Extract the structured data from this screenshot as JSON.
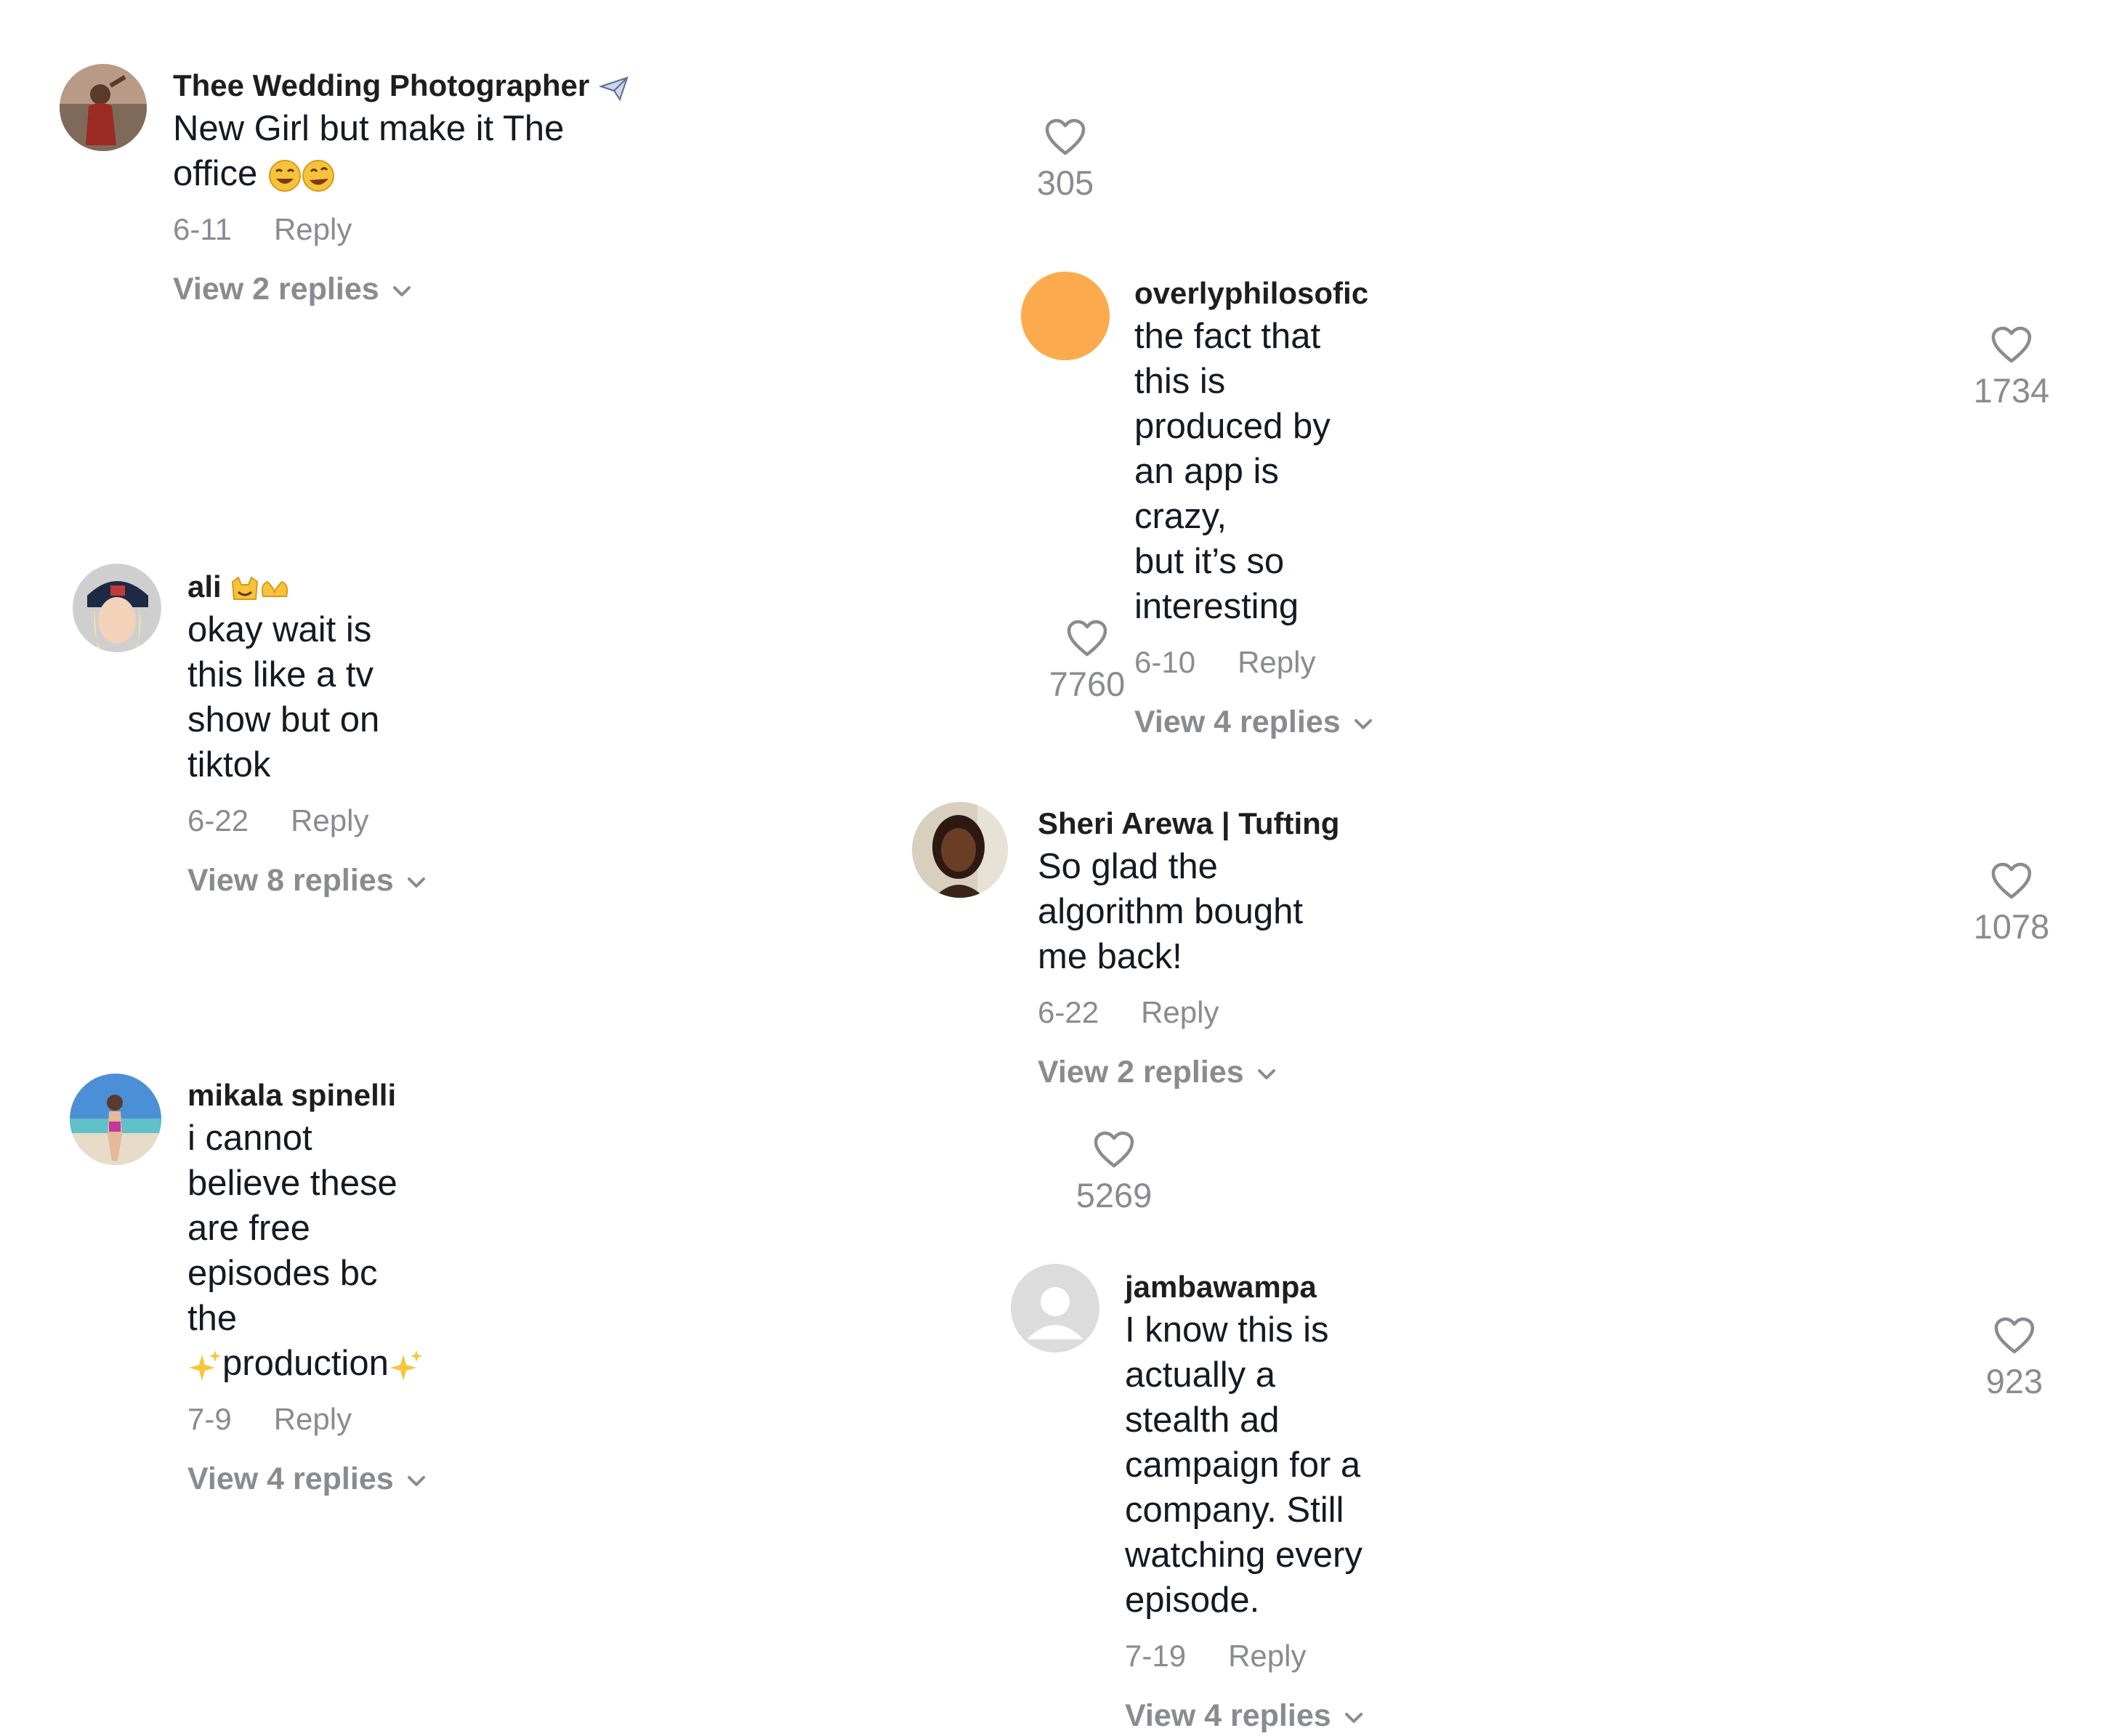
{
  "comments": [
    {
      "username": "Thee Wedding Photographer",
      "username_icon": "airplane-icon",
      "text": "New Girl but make it The office",
      "emojis": [
        "joy-emoji",
        "rofl-emoji"
      ],
      "date": "6-11",
      "reply_label": "Reply",
      "replies_label": "View 2 replies",
      "likes": "305"
    },
    {
      "username": "overlyphilosofic",
      "text_line1": "the fact that this is produced by an app is crazy,",
      "text_line2": "but it’s so interesting",
      "date": "6-10",
      "reply_label": "Reply",
      "replies_label": "View 4 replies",
      "likes": "1734",
      "avatar_color": "#fbab4e"
    },
    {
      "username": "ali",
      "username_emojis": [
        "cat-emoji",
        "heart-hands-emoji"
      ],
      "text": "okay wait is this like a tv show but on tiktok",
      "date": "6-22",
      "reply_label": "Reply",
      "replies_label": "View 8 replies",
      "likes": "7760"
    },
    {
      "username": "Sheri Arewa | Tufting",
      "text": "So glad the algorithm bought me back!",
      "date": "6-22",
      "reply_label": "Reply",
      "replies_label": "View 2 replies",
      "likes": "1078"
    },
    {
      "username": "mikala spinelli",
      "text_line1": "i cannot believe these are free episodes bc the",
      "text_line2": "production",
      "text_line2_emoji": "sparkles-emoji",
      "date": "7-9",
      "reply_label": "Reply",
      "replies_label": "View 4 replies",
      "likes": "5269"
    },
    {
      "username": "jambawampa",
      "text_line1": "I know this is actually a stealth ad campaign for a",
      "text_line2": "company. Still watching every episode.",
      "date": "7-19",
      "reply_label": "Reply",
      "replies_label": "View 4 replies",
      "likes": "923"
    }
  ],
  "colors": {
    "text": "#161823",
    "muted": "#8a8b91",
    "orange_avatar": "#fbab4e"
  }
}
